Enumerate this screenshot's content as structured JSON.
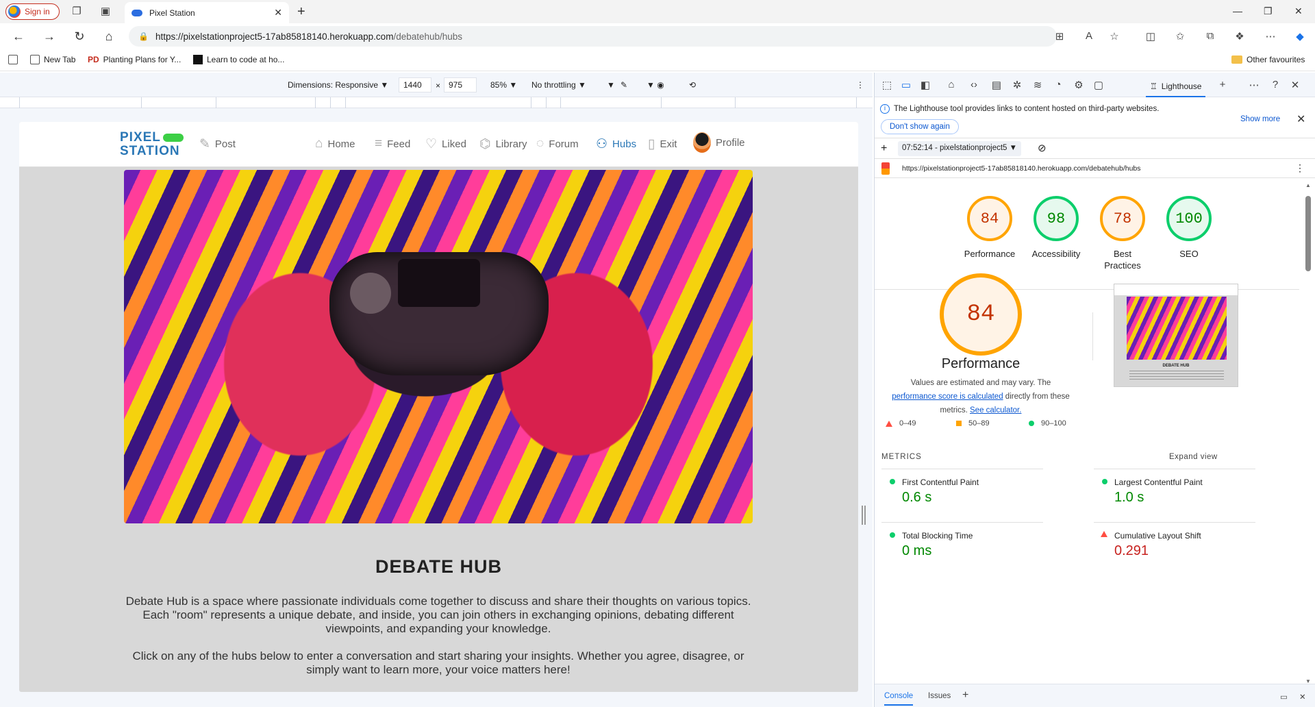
{
  "browser": {
    "signin_label": "Sign in",
    "tab_title": "Pixel Station",
    "url_host": "https://pixelstationproject5-17ab85818140.herokuapp.com",
    "url_path": "/debatehub/hubs",
    "bookmarks": [
      "New Tab",
      "Planting Plans for Y...",
      "Learn to code at ho..."
    ],
    "other_favourites": "Other favourites"
  },
  "device_toolbar": {
    "dimensions_label": "Dimensions: Responsive",
    "width": "1440",
    "height": "975",
    "times": "×",
    "zoom": "85%",
    "throttling": "No throttling"
  },
  "site": {
    "logo_line1": "PIXEL",
    "logo_line2": "STATION",
    "nav": {
      "post": "Post",
      "home": "Home",
      "feed": "Feed",
      "liked": "Liked",
      "library": "Library",
      "forum": "Forum",
      "hubs": "Hubs",
      "exit": "Exit",
      "profile": "Profile"
    },
    "hub_title": "DEBATE HUB",
    "hub_para1": "Debate Hub is a space where passionate individuals come together to discuss and share their thoughts on various topics. Each \"room\" represents a unique debate, and inside, you can join others in exchanging opinions, debating different viewpoints, and expanding your knowledge.",
    "hub_para2": "Click on any of the hubs below to enter a conversation and start sharing your insights. Whether you agree, disagree, or simply want to learn more, your voice matters here!"
  },
  "devtools": {
    "lighthouse_tab": "Lighthouse",
    "info_text": "The Lighthouse tool provides links to content hosted on third-party websites.",
    "dont_show": "Don't show again",
    "show_more": "Show more",
    "report_select": "07:52:14 - pixelstationproject5",
    "report_url": "https://pixelstationproject5-17ab85818140.herokuapp.com/debatehub/hubs",
    "scores": [
      {
        "label": "Performance",
        "value": "84"
      },
      {
        "label": "Accessibility",
        "value": "98"
      },
      {
        "label": "Best Practices",
        "value": "78"
      },
      {
        "label": "SEO",
        "value": "100"
      }
    ],
    "perf_big": "84",
    "perf_title": "Performance",
    "perf_desc1": "Values are estimated and may vary. The",
    "perf_link": "performance score is calculated",
    "perf_desc2": "directly from these metrics.",
    "perf_calc": "See calculator.",
    "legend": {
      "red": "0–49",
      "orange": "50–89",
      "green": "90–100"
    },
    "thumb_title": "DEBATE HUB",
    "metrics_header": "METRICS",
    "expand_view": "Expand view",
    "metrics": [
      {
        "name": "First Contentful Paint",
        "value": "0.6 s"
      },
      {
        "name": "Largest Contentful Paint",
        "value": "1.0 s"
      },
      {
        "name": "Total Blocking Time",
        "value": "0 ms"
      },
      {
        "name": "Cumulative Layout Shift",
        "value": "0.291"
      }
    ],
    "drawer_tabs": [
      "Console",
      "Issues"
    ]
  }
}
